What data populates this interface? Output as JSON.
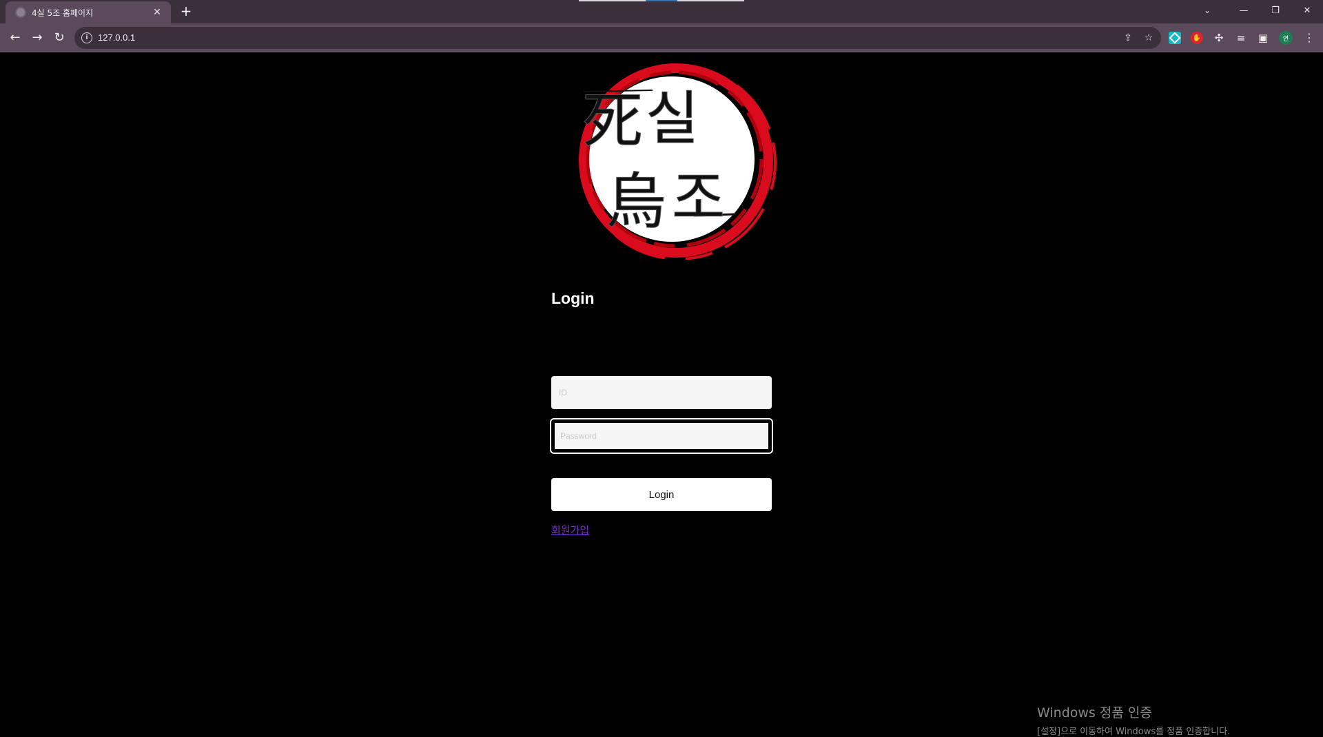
{
  "browser": {
    "tab_title": "4실 5조 홈페이지",
    "tab_close": "✕",
    "new_tab": "+",
    "url": "127.0.0.1",
    "avatar_letter": "연",
    "window_controls": {
      "minimize": "—",
      "restore": "❐",
      "close": "✕"
    }
  },
  "logo": {
    "characters": [
      "死",
      "실",
      "烏",
      "조"
    ],
    "ring_color": "#d90b1c",
    "disc_color": "#ffffff"
  },
  "login": {
    "title": "Login",
    "id_placeholder": "ID",
    "password_placeholder": "Password",
    "button_label": "Login",
    "signup_link": "회원가입"
  },
  "watermark": {
    "title": "Windows 정품 인증",
    "subtitle": "[설정]으로 이동하여 Windows를 정품 인증합니다."
  },
  "colors": {
    "page_background": "#000000",
    "chrome_frame": "#3b2f3c",
    "chrome_toolbar": "#5a4a5b",
    "link": "#7b2fd6"
  }
}
